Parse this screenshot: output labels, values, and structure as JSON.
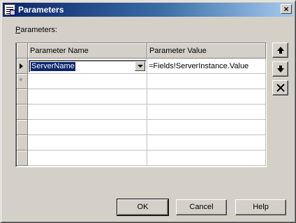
{
  "window": {
    "title": "Parameters",
    "close_label": "×"
  },
  "params_label": {
    "mnemonic": "P",
    "rest": "arameters:"
  },
  "grid": {
    "columns": [
      "Parameter Name",
      "Parameter Value"
    ],
    "rows": [
      {
        "name": "ServerName",
        "value": "=Fields!ServerInstance.Value"
      }
    ],
    "new_row_marker": "*"
  },
  "buttons": {
    "ok": "OK",
    "cancel": "Cancel",
    "help": "Help"
  }
}
